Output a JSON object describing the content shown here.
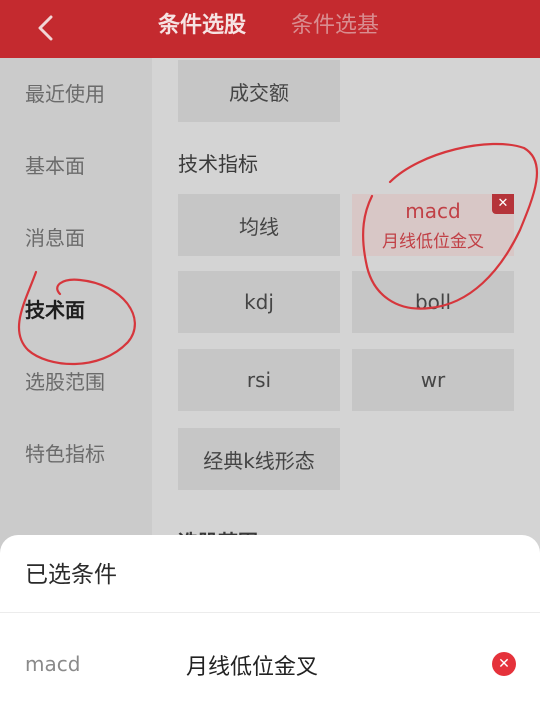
{
  "header": {
    "tabs": [
      {
        "label": "条件选股",
        "active": true
      },
      {
        "label": "条件选基",
        "active": false
      }
    ],
    "color": "#c42a2f"
  },
  "sidebar": {
    "items": [
      {
        "label": "最近使用",
        "active": false
      },
      {
        "label": "基本面",
        "active": false
      },
      {
        "label": "消息面",
        "active": false
      },
      {
        "label": "技术面",
        "active": true
      },
      {
        "label": "选股范围",
        "active": false
      },
      {
        "label": "特色指标",
        "active": false
      }
    ]
  },
  "content": {
    "top_chip": "成交额",
    "section_title": "技术指标",
    "chips": [
      {
        "label": "均线"
      },
      {
        "label": "macd",
        "sub": "月线低位金叉",
        "selected": true
      },
      {
        "label": "kdj"
      },
      {
        "label": "boll"
      },
      {
        "label": "rsi"
      },
      {
        "label": "wr"
      },
      {
        "label": "经典k线形态"
      }
    ],
    "next_section_title": "选股范围"
  },
  "sheet": {
    "title": "已选条件",
    "selected": [
      {
        "key": "macd",
        "value": "月线低位金叉"
      }
    ]
  },
  "icons": {
    "back": "chevron-left-icon",
    "chip_close": "close-icon",
    "remove": "remove-circle-icon"
  },
  "colors": {
    "accent": "#c42a2f",
    "remove": "#e5323b"
  }
}
